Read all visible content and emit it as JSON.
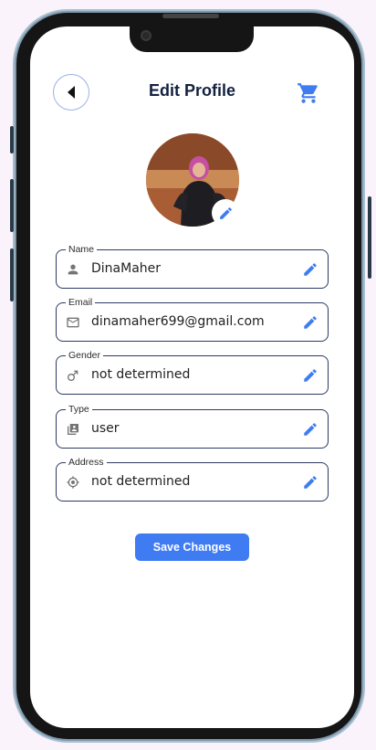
{
  "header": {
    "title": "Edit Profile",
    "back_icon": "back-arrow-icon",
    "cart_icon": "cart-icon"
  },
  "avatar": {
    "edit_icon": "pencil-icon"
  },
  "fields": [
    {
      "label": "Name",
      "value": "DinaMaher",
      "icon": "person-icon"
    },
    {
      "label": "Email",
      "value": "dinamaher699@gmail.com",
      "icon": "mail-icon"
    },
    {
      "label": "Gender",
      "value": "not determined",
      "icon": "gender-icon"
    },
    {
      "label": "Type",
      "value": "user",
      "icon": "type-icon"
    },
    {
      "label": "Address",
      "value": "not determined",
      "icon": "location-icon"
    }
  ],
  "save_label": "Save Changes",
  "colors": {
    "accent": "#3f7cf2",
    "title": "#13213f",
    "field_border": "#2c3a64",
    "background": "#fbf3fb"
  }
}
